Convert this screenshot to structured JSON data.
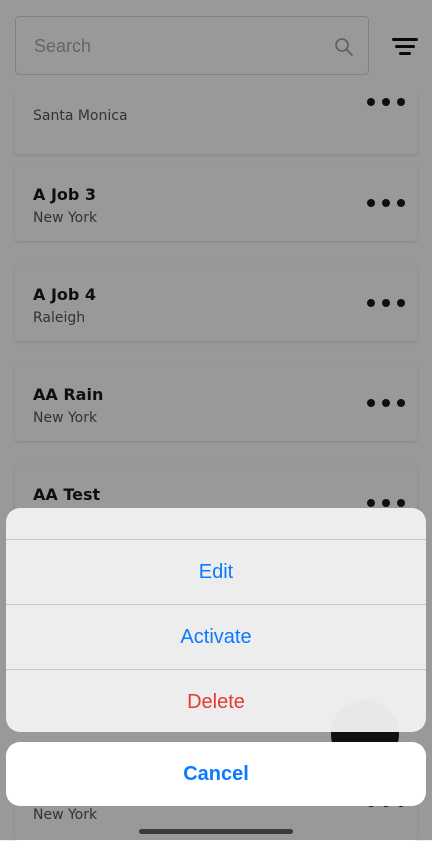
{
  "search": {
    "placeholder": "Search"
  },
  "filter_icon": "filter-lines-icon",
  "jobs": [
    {
      "title": "",
      "location": "Santa Monica"
    },
    {
      "title": "A Job 3",
      "location": "New York"
    },
    {
      "title": "A Job 4",
      "location": "Raleigh"
    },
    {
      "title": "AA Rain",
      "location": "New York"
    },
    {
      "title": "AA Test",
      "location": ""
    },
    {
      "title": "",
      "location": "New York"
    }
  ],
  "action_sheet": {
    "items": [
      {
        "label": "Edit"
      },
      {
        "label": "Activate"
      },
      {
        "label": "Delete",
        "color": "#e53935"
      }
    ],
    "cancel_label": "Cancel",
    "accent_color": "#0a7aff"
  }
}
